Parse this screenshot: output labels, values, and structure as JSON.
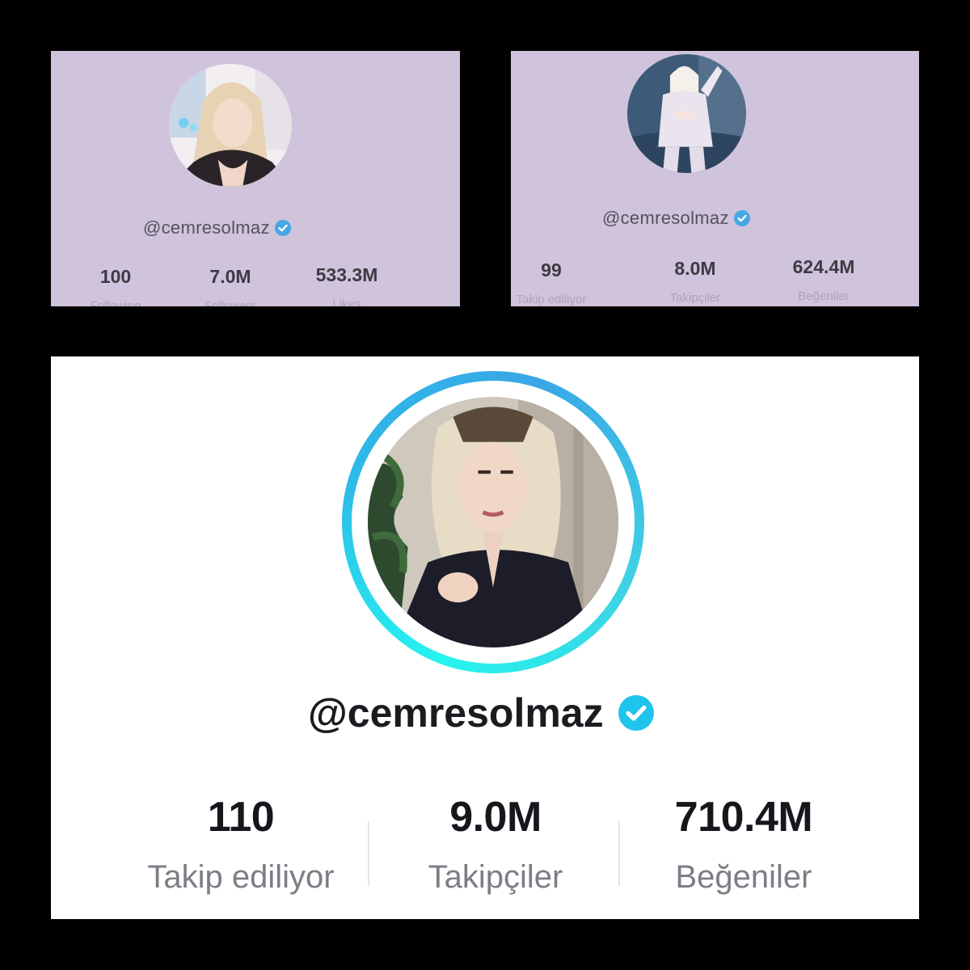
{
  "colors": {
    "page_background": "#000000",
    "small_panel_background": "#d0c3dc",
    "large_panel_background": "#ffffff",
    "verified_badge": "#20c3ec",
    "story_ring": "#25f4ee"
  },
  "icons": {
    "verified": "verified-check-badge-icon"
  },
  "panels": [
    {
      "handle": "@cemresolmaz",
      "stats": [
        {
          "value": "100",
          "label": "Following"
        },
        {
          "value": "7.0M",
          "label": "Followers"
        },
        {
          "value": "533.3M",
          "label": "Likes"
        }
      ]
    },
    {
      "handle": "@cemresolmaz",
      "stats": [
        {
          "value": "99",
          "label": "Takip ediliyor"
        },
        {
          "value": "8.0M",
          "label": "Takipçiler"
        },
        {
          "value": "624.4M",
          "label": "Beğeniler"
        }
      ]
    },
    {
      "handle": "@cemresolmaz",
      "stats": [
        {
          "value": "110",
          "label": "Takip ediliyor"
        },
        {
          "value": "9.0M",
          "label": "Takipçiler"
        },
        {
          "value": "710.4M",
          "label": "Beğeniler"
        }
      ]
    }
  ]
}
